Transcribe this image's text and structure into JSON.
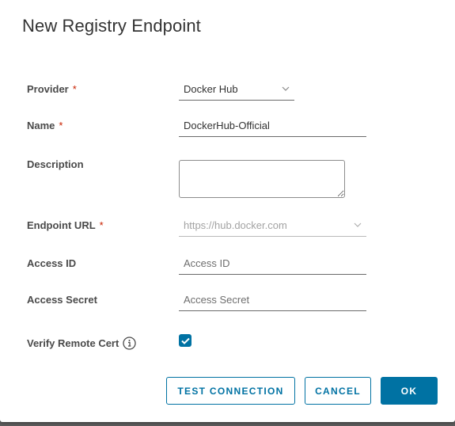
{
  "dialog": {
    "title": "New Registry Endpoint"
  },
  "form": {
    "provider": {
      "label": "Provider",
      "required_mark": "*",
      "value": "Docker Hub"
    },
    "name": {
      "label": "Name",
      "required_mark": "*",
      "value": "DockerHub-Official"
    },
    "description": {
      "label": "Description",
      "value": ""
    },
    "endpoint_url": {
      "label": "Endpoint URL",
      "required_mark": "*",
      "value": "https://hub.docker.com",
      "disabled": true
    },
    "access_id": {
      "label": "Access ID",
      "placeholder": "Access ID"
    },
    "access_secret": {
      "label": "Access Secret",
      "placeholder": "Access Secret"
    },
    "verify_remote_cert": {
      "label": "Verify Remote Cert",
      "checked": true
    }
  },
  "buttons": {
    "test_connection": "TEST CONNECTION",
    "cancel": "CANCEL",
    "ok": "OK"
  },
  "colors": {
    "primary": "#0072a3",
    "required": "#c92100",
    "overlay": "#5b5b5b"
  },
  "icons": {
    "dropdown": "chevron-down-icon",
    "info": "info-circle-icon",
    "check": "check-icon"
  }
}
